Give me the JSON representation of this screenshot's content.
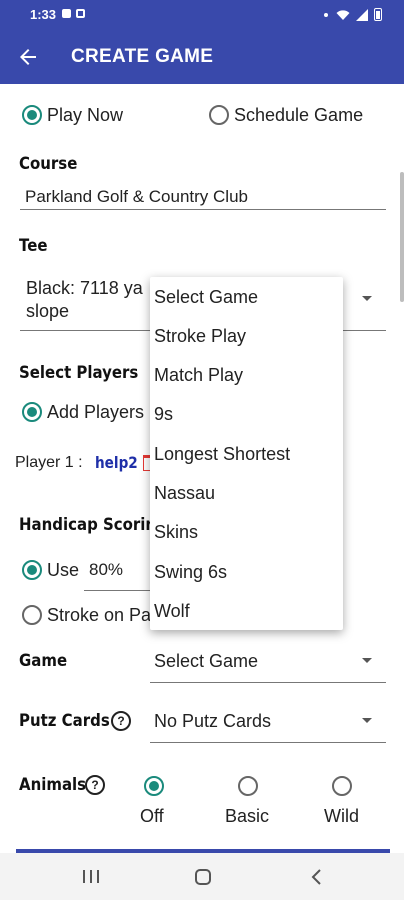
{
  "status_bar": {
    "time": "1:33"
  },
  "app_bar": {
    "title": "CREATE GAME"
  },
  "mode": {
    "play_now": "Play Now",
    "schedule_game": "Schedule Game"
  },
  "course": {
    "label": "Course",
    "value": "Parkland Golf & Country Club"
  },
  "tee": {
    "label": "Tee",
    "value_line1": "Black: 7118 ya",
    "value_line2": "slope"
  },
  "players": {
    "label": "Select Players",
    "add_players": "Add Players",
    "player1_prefix": "Player 1 :",
    "player1_name": "help2"
  },
  "handicap": {
    "label": "Handicap Scoring",
    "use_label": "Use",
    "percent": "80%",
    "stroke_on_label": "Stroke on Pa"
  },
  "game": {
    "label": "Game",
    "selected": "Select Game"
  },
  "putz": {
    "label": "Putz Cards",
    "help_glyph": "?",
    "selected": "No Putz Cards"
  },
  "animals": {
    "label": "Animals",
    "help_glyph": "?",
    "options": [
      "Off",
      "Basic",
      "Wild"
    ]
  },
  "dropdown": {
    "items": [
      "Select Game",
      "Stroke Play",
      "Match Play",
      "9s",
      "Longest Shortest",
      "Nassau",
      "Skins",
      "Swing 6s",
      "Wolf"
    ]
  },
  "colors": {
    "primary": "#3949ab",
    "radio_accent": "#1a8a7c",
    "player_link": "#1f2fa8",
    "delete": "#e53935"
  }
}
